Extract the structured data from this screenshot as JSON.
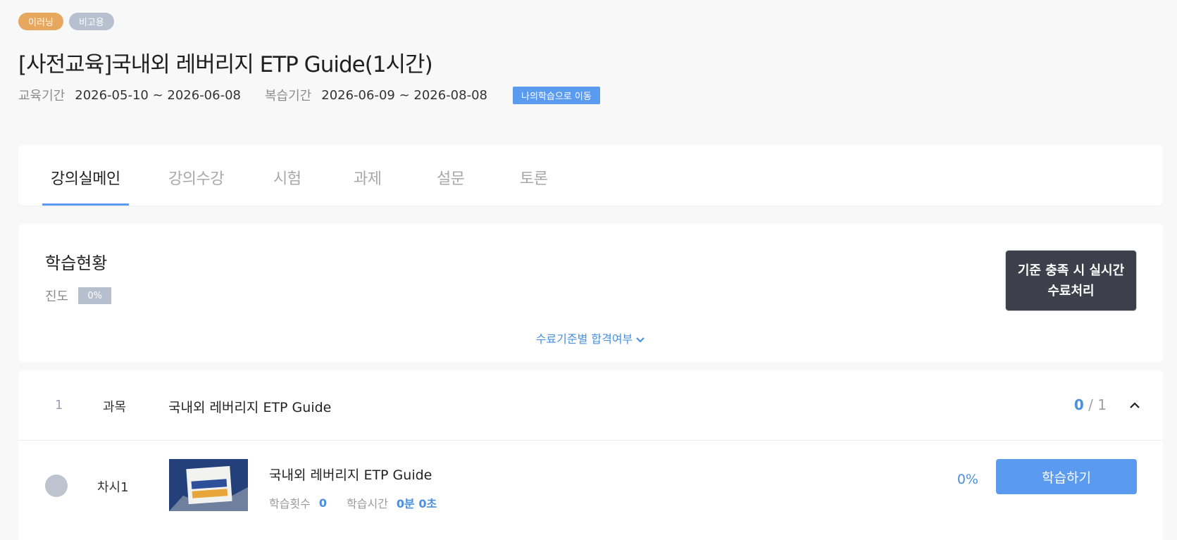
{
  "badges": [
    "이러닝",
    "비고용"
  ],
  "title": "[사전교육]국내외 레버리지 ETP Guide(1시간)",
  "period": {
    "edu_label": "교육기간",
    "edu_value": "2026-05-10 ~ 2026-06-08",
    "review_label": "복습기간",
    "review_value": "2026-06-09 ~ 2026-08-08",
    "go_button": "나의학습으로 이동"
  },
  "tabs": [
    {
      "label": "강의실메인",
      "active": true
    },
    {
      "label": "강의수강",
      "active": false
    },
    {
      "label": "시험",
      "active": false
    },
    {
      "label": "과제",
      "active": false
    },
    {
      "label": "설문",
      "active": false
    },
    {
      "label": "토론",
      "active": false
    }
  ],
  "status": {
    "title": "학습현황",
    "progress_label": "진도",
    "progress_value": "0%",
    "realtime_line1": "기준 충족 시 실시간",
    "realtime_line2": "수료처리",
    "criteria_link": "수료기준별 합격여부"
  },
  "course": {
    "number": "1",
    "type": "과목",
    "name": "국내외 레버리지 ETP Guide",
    "completed": "0",
    "total": "/ 1"
  },
  "lesson": {
    "seq": "차시1",
    "title": "국내외 레버리지 ETP Guide",
    "count_label": "학습횟수",
    "count_value": "0",
    "time_label": "학습시간",
    "time_value": "0분 0초",
    "percent": "0%",
    "study_button": "학습하기"
  },
  "colors": {
    "accent": "#5b9bef",
    "link": "#4a8fe0",
    "badge_orange": "#e6a75e",
    "badge_gray": "#b7c0cf",
    "dark_button": "#3f3f4b"
  }
}
